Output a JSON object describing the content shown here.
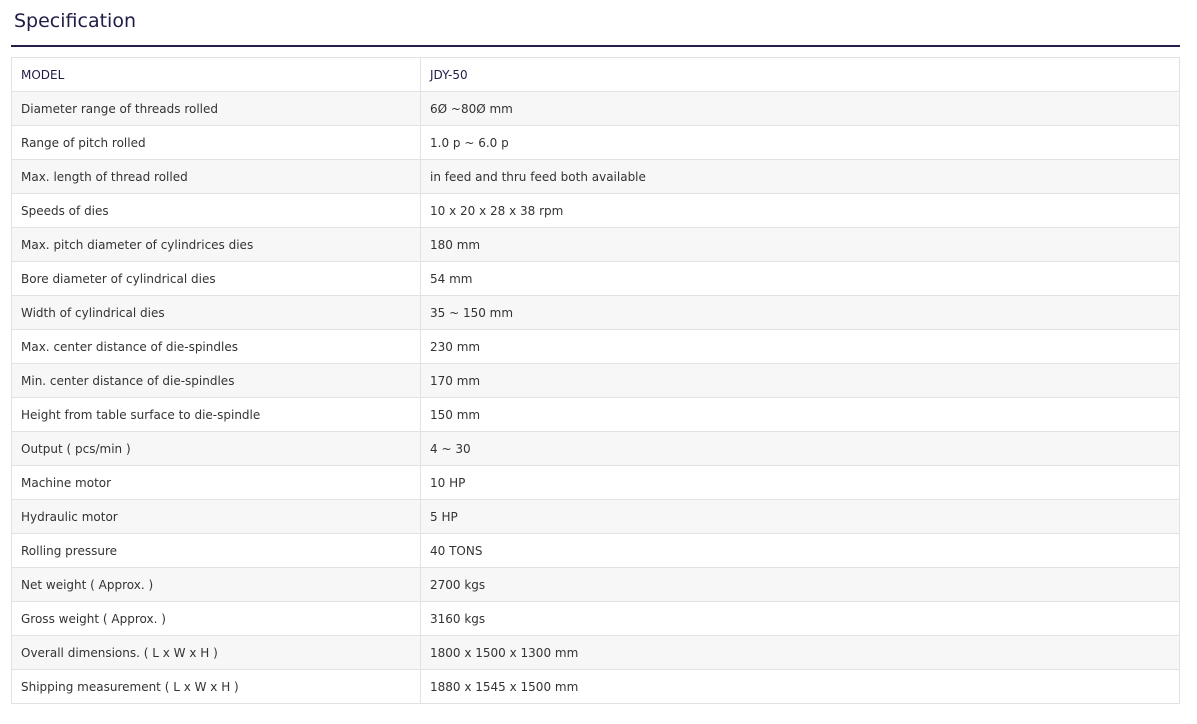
{
  "section": {
    "title": "Specification"
  },
  "colors": {
    "title": "#1f1d45",
    "rule": "#22204a",
    "row_alt": "#f7f7f7",
    "border": "#e2e2e2"
  },
  "spec_table": {
    "rows": [
      {
        "label": "MODEL",
        "value": "JDY-50"
      },
      {
        "label": "Diameter range of threads rolled",
        "value": "6Ø ~80Ø mm"
      },
      {
        "label": "Range of pitch rolled",
        "value": "1.0 p ~ 6.0 p"
      },
      {
        "label": "Max. length of thread rolled",
        "value": "in feed and thru feed both available"
      },
      {
        "label": "Speeds of dies",
        "value": "10 x 20 x 28 x 38 rpm"
      },
      {
        "label": "Max. pitch diameter of cylindrices dies",
        "value": "180 mm"
      },
      {
        "label": "Bore diameter of cylindrical dies",
        "value": "54 mm"
      },
      {
        "label": "Width of cylindrical dies",
        "value": "35 ~ 150 mm"
      },
      {
        "label": "Max. center distance of die-spindles",
        "value": "230 mm"
      },
      {
        "label": "Min. center distance of die-spindles",
        "value": "170 mm"
      },
      {
        "label": "Height from table surface to die-spindle",
        "value": "150 mm"
      },
      {
        "label": "Output ( pcs/min )",
        "value": "4 ~ 30"
      },
      {
        "label": "Machine motor",
        "value": "10 HP"
      },
      {
        "label": "Hydraulic motor",
        "value": "5 HP"
      },
      {
        "label": "Rolling pressure",
        "value": "40 TONS"
      },
      {
        "label": "Net weight ( Approx. )",
        "value": "2700 kgs"
      },
      {
        "label": "Gross weight ( Approx. )",
        "value": "3160 kgs"
      },
      {
        "label": "Overall dimensions. ( L x W x H )",
        "value": "1800 x 1500 x 1300 mm"
      },
      {
        "label": "Shipping measurement ( L x W x H )",
        "value": "1880 x 1545 x 1500 mm"
      }
    ]
  }
}
